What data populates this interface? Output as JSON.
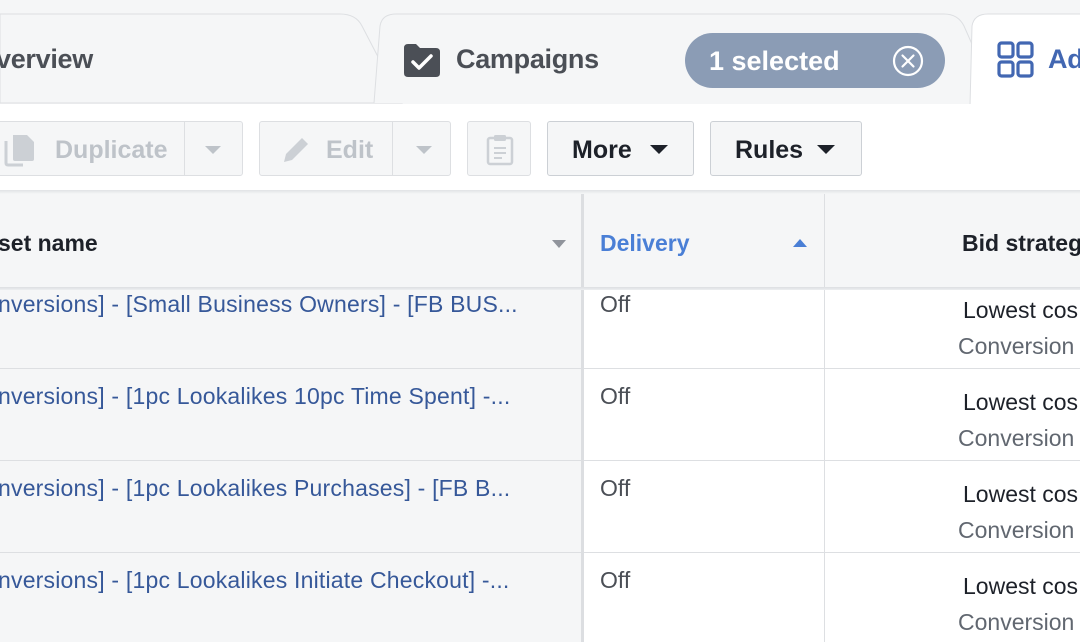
{
  "tabs": {
    "overview": "verview",
    "campaigns": "Campaigns",
    "ads": "Ad",
    "selected_pill": "1 selected"
  },
  "toolbar": {
    "duplicate": "Duplicate",
    "edit": "Edit",
    "more": "More",
    "rules": "Rules"
  },
  "table": {
    "headers": {
      "name": "set name",
      "delivery": "Delivery",
      "bid_strategy": "Bid strateg"
    },
    "rows": [
      {
        "name": "nversions] - [Small Business Owners] - [FB BUS...",
        "delivery": "Off",
        "bid_line1": "Lowest cos",
        "bid_line2": "Conversion"
      },
      {
        "name": "nversions] - [1pc Lookalikes 10pc Time Spent] -...",
        "delivery": "Off",
        "bid_line1": "Lowest cos",
        "bid_line2": "Conversion"
      },
      {
        "name": "nversions] - [1pc Lookalikes Purchases] - [FB B...",
        "delivery": "Off",
        "bid_line1": "Lowest cos",
        "bid_line2": "Conversion"
      },
      {
        "name": "nversions] - [1pc Lookalikes Initiate Checkout] -...",
        "delivery": "Off",
        "bid_line1": "Lowest cos",
        "bid_line2": "Conversion"
      }
    ]
  },
  "colors": {
    "accent_blue": "#4267b2",
    "link_blue": "#365899",
    "sort_blue": "#4a7fd6",
    "pill_bg": "#8b9cb5"
  },
  "icons": [
    "folder-check-icon",
    "grid-icon",
    "close-circle-icon",
    "copy-icon",
    "pencil-icon",
    "clipboard-icon",
    "caret-down-icon",
    "sort-up-icon"
  ]
}
